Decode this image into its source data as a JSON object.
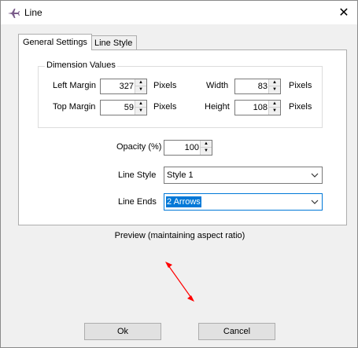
{
  "window": {
    "title": "Line",
    "close_glyph": "✕"
  },
  "tabs": [
    {
      "label": "General Settings",
      "active": true
    },
    {
      "label": "Line Style",
      "active": false
    }
  ],
  "dimension_group": {
    "legend": "Dimension Values",
    "left_margin": {
      "label": "Left Margin",
      "value": "327",
      "unit": "Pixels"
    },
    "top_margin": {
      "label": "Top Margin",
      "value": "59",
      "unit": "Pixels"
    },
    "width": {
      "label": "Width",
      "value": "83",
      "unit": "Pixels"
    },
    "height": {
      "label": "Height",
      "value": "108",
      "unit": "Pixels"
    }
  },
  "opacity": {
    "label": "Opacity (%)",
    "value": "100"
  },
  "line_style": {
    "label": "Line Style",
    "value": "Style 1"
  },
  "line_ends": {
    "label": "Line Ends",
    "value": "2 Arrows"
  },
  "preview": {
    "label": "Preview (maintaining aspect ratio)",
    "line_color": "#ff0000"
  },
  "buttons": {
    "ok": "Ok",
    "cancel": "Cancel"
  },
  "colors": {
    "accent": "#0078d7",
    "preview_line": "#ff0000"
  }
}
